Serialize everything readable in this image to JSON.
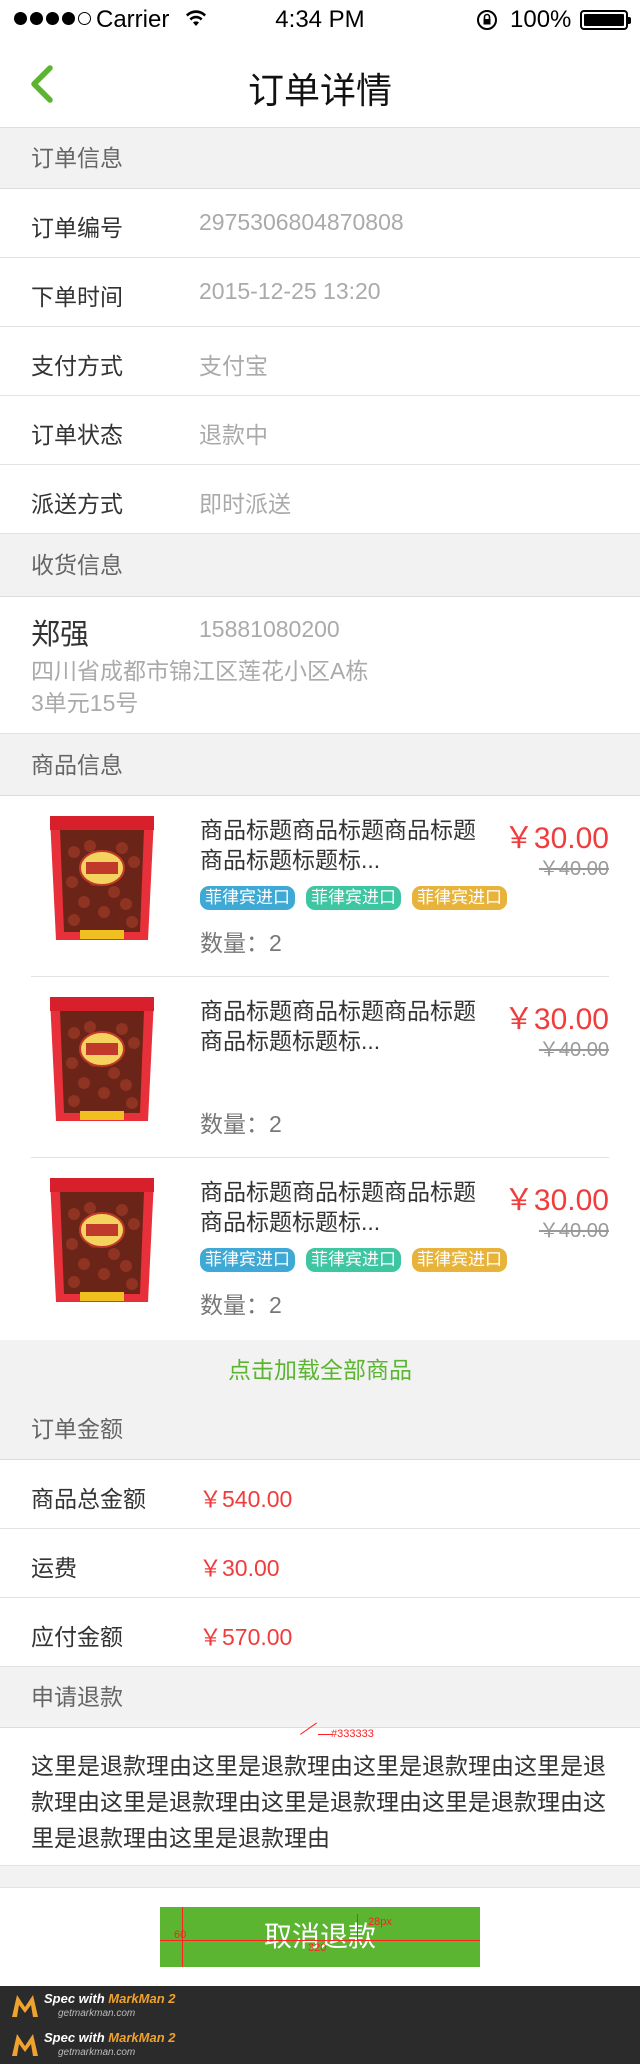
{
  "status_bar": {
    "carrier": "Carrier",
    "time": "4:34 PM",
    "battery": "100%"
  },
  "nav": {
    "title": "订单详情"
  },
  "order_info": {
    "heading": "订单信息",
    "rows": [
      {
        "label": "订单编号",
        "value": "2975306804870808"
      },
      {
        "label": "下单时间",
        "value": "2015-12-25 13:20"
      },
      {
        "label": "支付方式",
        "value": "支付宝"
      },
      {
        "label": "订单状态",
        "value": "退款中"
      },
      {
        "label": "派送方式",
        "value": "即时派送"
      }
    ]
  },
  "shipping": {
    "heading": "收货信息",
    "name": "郑强",
    "phone": "15881080200",
    "address": "四川省成都市锦江区莲花小区A栋3单元15号"
  },
  "products": {
    "heading": "商品信息",
    "items": [
      {
        "title": "商品标题商品标题商品标题商品标题标题标...",
        "price": "￥30.00",
        "old_price": "￥40.00",
        "tags": [
          "菲律宾进口",
          "菲律宾进口",
          "菲律宾进口"
        ],
        "quantity": "数量：2"
      },
      {
        "title": "商品标题商品标题商品标题商品标题标题标...",
        "price": "￥30.00",
        "old_price": "￥40.00",
        "tags": [],
        "quantity": "数量：2"
      },
      {
        "title": "商品标题商品标题商品标题商品标题标题标...",
        "price": "￥30.00",
        "old_price": "￥40.00",
        "tags": [
          "菲律宾进口",
          "菲律宾进口",
          "菲律宾进口"
        ],
        "quantity": "数量：2"
      }
    ],
    "load_all": "点击加载全部商品",
    "tag_colors": [
      "#3fa9d6",
      "#3dc6a1",
      "#e8b33a"
    ],
    "product_image": "red-bean-bag-image"
  },
  "amount": {
    "heading": "订单金额",
    "rows": [
      {
        "label": "商品总金额",
        "value": "￥540.00"
      },
      {
        "label": "运费",
        "value": "￥30.00"
      },
      {
        "label": "应付金额",
        "value": "￥570.00"
      }
    ]
  },
  "refund": {
    "heading": "申请退款",
    "reason": "这里是退款理由这里是退款理由这里是退款理由这里是退款理由这里是退款理由这里是退款理由这里是退款理由这里是退款理由这里是退款理由"
  },
  "bottom": {
    "cancel_button": "取消退款"
  },
  "annotations": {
    "color": "#333333",
    "height": "60",
    "width": "320",
    "font_size": "28px"
  },
  "markman": [
    {
      "line1_prefix": "Spec with ",
      "brand": "MarkMan 2",
      "site": "getmarkman.com"
    },
    {
      "line1_prefix": "Spec with ",
      "brand": "MarkMan 2",
      "site": "getmarkman.com"
    }
  ],
  "colors": {
    "accent": "#5cb531",
    "price_red": "#f03c3c",
    "section_bg": "#f2f2f2"
  }
}
